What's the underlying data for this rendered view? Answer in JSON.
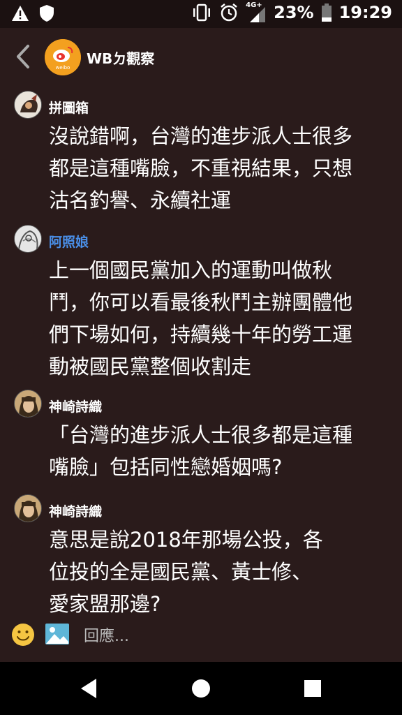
{
  "status_bar": {
    "network": "4G+",
    "battery_percent": "23%",
    "time": "19:29",
    "icons": [
      "warning-icon",
      "shield-icon",
      "vibrate-icon",
      "alarm-icon",
      "signal-icon",
      "battery-icon"
    ]
  },
  "header": {
    "title": "WBㄉ觀察",
    "logo_text": "weibo"
  },
  "comments": [
    {
      "author": "拼圖箱",
      "body": "沒說錯啊，台灣的進步派人士很多\n都是這種嘴臉，不重視結果，只想\n沽名釣譽、永續社運"
    },
    {
      "author": "阿照娘",
      "body": "上一個國民黨加入的運動叫做秋\n鬥，你可以看最後秋鬥主辦團體他\n們下場如何，持續幾十年的勞工運\n動被國民黨整個收割走"
    },
    {
      "author": "神崎詩織",
      "body": "「台灣的進步派人士很多都是這種\n嘴臉」包括同性戀婚姻嗎?"
    },
    {
      "author": "神崎詩織",
      "body": "意思是說2018年那場公投，各\n位投的全是國民黨、黃士修、\n愛家盟那邊?"
    }
  ],
  "reply_bar": {
    "placeholder": "回應..."
  },
  "colors": {
    "background": "#2a1b1b",
    "status_bg": "#1b1111",
    "author_highlight": "#4a8fe8",
    "emoji": "#f5c542",
    "image_icon": "#5fb6d8"
  }
}
